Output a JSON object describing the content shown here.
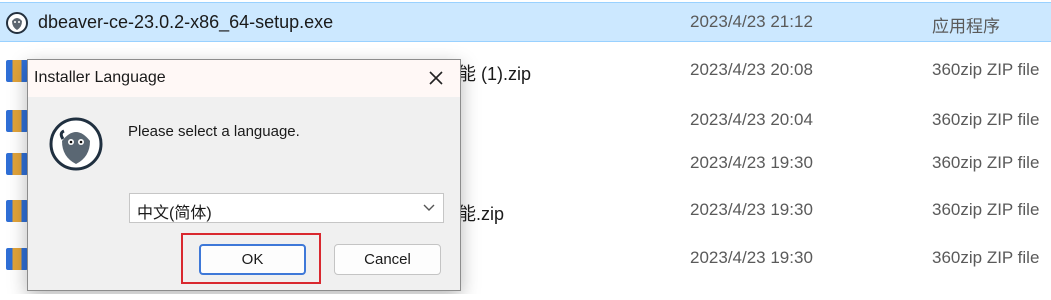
{
  "files": [
    {
      "name": "dbeaver-ce-23.0.2-x86_64-setup.exe",
      "date": "2023/4/23 21:12",
      "type": "应用程序",
      "icon": "dbeaver-icon",
      "selected": true
    },
    {
      "name": "能 (1).zip",
      "date": "2023/4/23 20:08",
      "type": "360zip ZIP file",
      "icon": "zip-icon"
    },
    {
      "name": "",
      "date": "2023/4/23 20:04",
      "type": "360zip ZIP file",
      "icon": "zip-icon"
    },
    {
      "name": "",
      "date": "2023/4/23 19:30",
      "type": "360zip ZIP file",
      "icon": "zip-icon"
    },
    {
      "name": "能.zip",
      "date": "2023/4/23 19:30",
      "type": "360zip ZIP file",
      "icon": "zip-icon"
    },
    {
      "name": "",
      "date": "2023/4/23 19:30",
      "type": "360zip ZIP file",
      "icon": "zip-icon"
    }
  ],
  "dialog": {
    "title": "Installer Language",
    "prompt": "Please select a language.",
    "selected_language": "中文(简体)",
    "ok_label": "OK",
    "cancel_label": "Cancel",
    "highlight_color": "#d9282f"
  }
}
